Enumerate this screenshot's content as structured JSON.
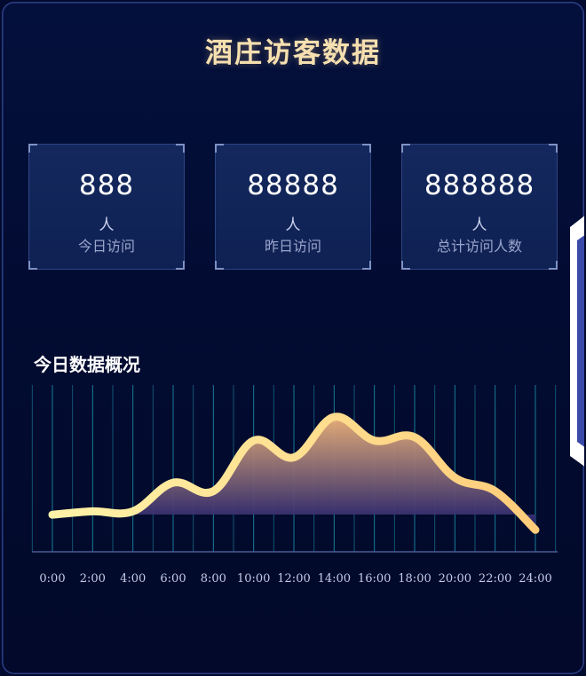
{
  "title": "酒庄访客数据",
  "stats": [
    {
      "value": "888",
      "unit": "人",
      "label": "今日访问"
    },
    {
      "value": "88888",
      "unit": "人",
      "label": "昨日访问"
    },
    {
      "value": "888888",
      "unit": "人",
      "label": "总计访问人数"
    }
  ],
  "section_title": "今日数据概况",
  "colors": {
    "title": "#f6e0b0",
    "line_start": "#fff3a8",
    "line_end": "#ffcc7a",
    "area_top": "#f0b47a",
    "area_bottom": "#1c1c6e",
    "grid": "#1fa3b8"
  },
  "chart_data": {
    "type": "area",
    "title": "",
    "xlabel": "",
    "ylabel": "",
    "categories": [
      "0:00",
      "2:00",
      "4:00",
      "6:00",
      "8:00",
      "10:00",
      "12:00",
      "14:00",
      "16:00",
      "18:00",
      "20:00",
      "22:00",
      "24:00"
    ],
    "x_hours": [
      0,
      2,
      4,
      6,
      8,
      10,
      12,
      14,
      16,
      18,
      20,
      22,
      24
    ],
    "values": [
      22,
      24,
      24,
      41,
      36,
      66,
      56,
      80,
      66,
      68,
      44,
      36,
      13
    ],
    "ylim": [
      0,
      100
    ],
    "grid": "vertical",
    "legend": "none",
    "smooth": true
  }
}
